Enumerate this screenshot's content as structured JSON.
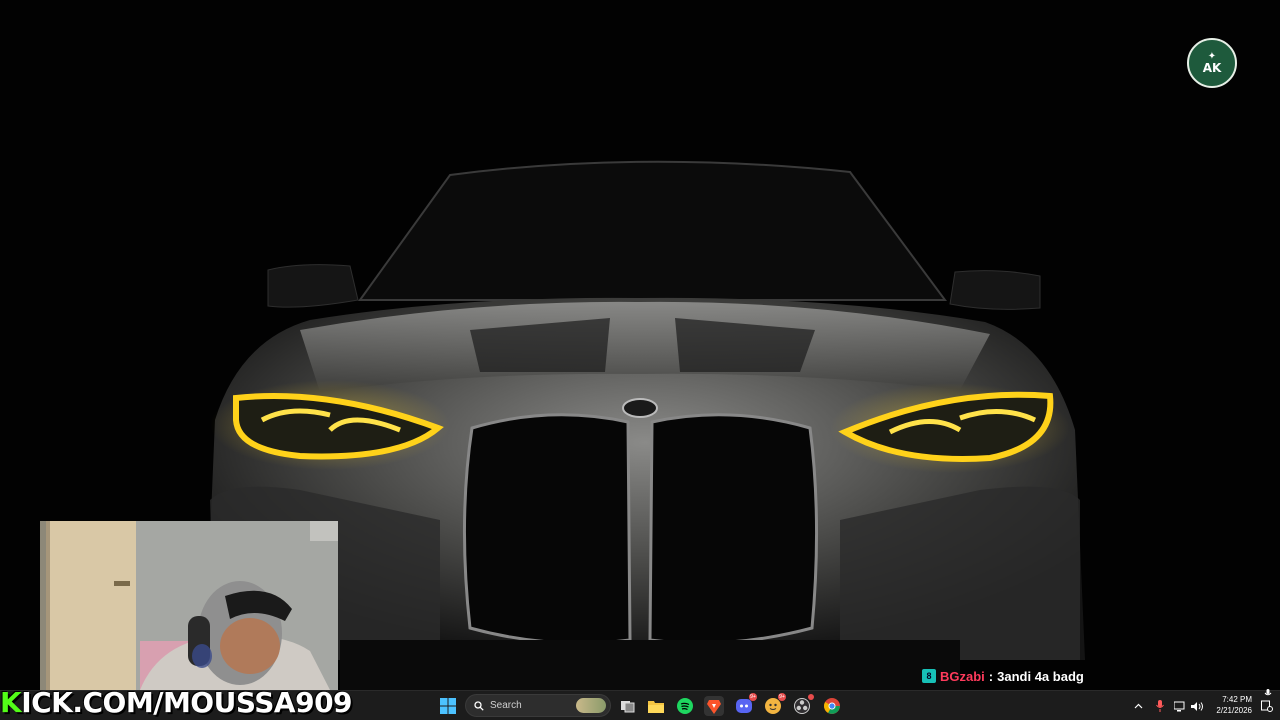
{
  "overlay": {
    "kick_prefix": "K",
    "kick_rest": "ICK.COM/MOUSSA909",
    "chat": {
      "badge_icon": "subscriber-badge-icon",
      "username": "BGzabi",
      "separator": ":",
      "message": "3andi 4a badg"
    },
    "logo_text": "AK"
  },
  "taskbar": {
    "search_placeholder": "Search",
    "pinned": [
      "windows-start-icon",
      "task-view-icon",
      "file-explorer-icon",
      "spotify-icon",
      "brave-icon",
      "discord-icon",
      "app-icon",
      "obs-icon",
      "chrome-icon"
    ],
    "badges": {
      "discord": "9+",
      "app": "9+"
    },
    "clock": {
      "time": "7:42 PM",
      "date": "2/21/2026"
    }
  },
  "colors": {
    "kick_green": "#53fc18",
    "chat_username": "#ff3b5c",
    "taskbar_bg": "#1c1c1c",
    "headlight_yellow": "#ffd21a"
  }
}
